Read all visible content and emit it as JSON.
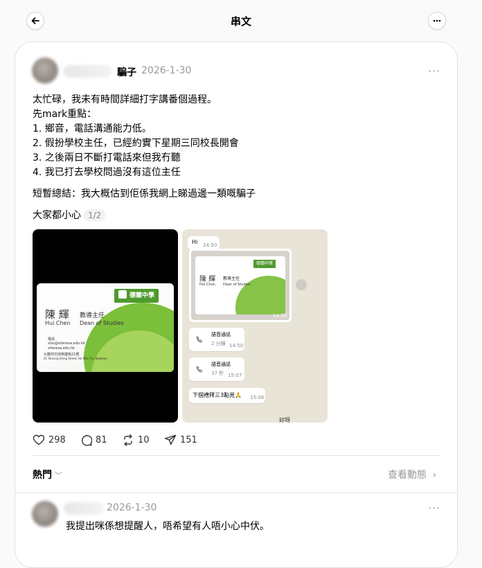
{
  "header": {
    "title": "串文"
  },
  "post": {
    "username": "騙子",
    "date": "2026-1-30",
    "lines": [
      "太忙碌，我未有時間詳細打字講番個過程。",
      "先mark重點：",
      "1. 鄉音，電話溝通能力低。",
      "2. 假扮學校主任，已經約實下星期三同校長開會",
      "3. 之後兩日不斷打電話來但我冇聽",
      "4. 我已打去學校問過沒有這位主任"
    ],
    "summary": "短暫總結：我大概估到佢係我網上睇過邊一類嘅騙子",
    "caution": "大家都小心",
    "image_counter": "1/2",
    "card": {
      "school": "德蘭中學",
      "name_zh": "陳 輝",
      "title_zh": "教導主任",
      "name_en": "Hui Chen",
      "title_en": "Dean of Studies",
      "phone_label": "電話",
      "email": "stss@stteresa.edu.hk",
      "web": "stteresa.edu.hk",
      "address_zh": "九龍何文田常盛街21號",
      "address_en": "21 Sheung Shing Street, Ho Man Tin, Kowloon"
    },
    "chat": {
      "hi": "Hi",
      "hi_time": "14:50",
      "photo_time": "14:50",
      "call1_title": "語音通話",
      "call1_duration": "2 分鐘",
      "call1_time": "14:50",
      "call2_title": "語音通話",
      "call2_duration": "37 秒",
      "call2_time": "15:07",
      "message": "下個禮拜三3點見🙏",
      "message_time": "15:08",
      "partial": "好呀"
    },
    "stats": {
      "likes": "298",
      "comments": "81",
      "reposts": "10",
      "shares": "151"
    }
  },
  "sort": {
    "label": "熱門",
    "activity": "查看動態"
  },
  "reply": {
    "date": "2026-1-30",
    "text": "我提出咪係想提醒人，唔希望有人唔小心中伏。"
  },
  "icons": [
    "arrow-left-icon",
    "more-icon",
    "heart-icon",
    "comment-icon",
    "repost-icon",
    "send-icon",
    "chevron-down-icon",
    "chevron-right-icon",
    "phone-icon"
  ]
}
